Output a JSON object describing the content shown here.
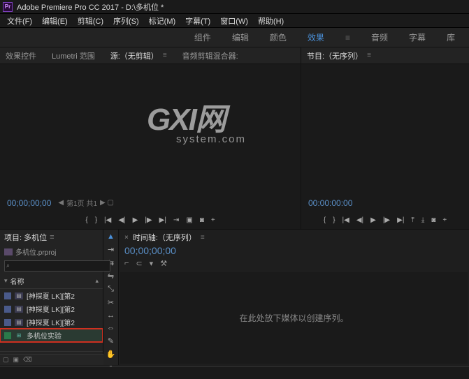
{
  "titlebar": {
    "app": "Adobe Premiere Pro CC 2017",
    "project_path": "D:\\多机位 *",
    "logo_text": "Pr"
  },
  "menubar": {
    "items": [
      "文件(F)",
      "编辑(E)",
      "剪辑(C)",
      "序列(S)",
      "标记(M)",
      "字幕(T)",
      "窗口(W)",
      "帮助(H)"
    ]
  },
  "workspace": {
    "tabs": [
      "组件",
      "编辑",
      "颜色",
      "效果",
      "音频",
      "字幕",
      "库"
    ],
    "active_index": 3
  },
  "source_panel": {
    "tabs": [
      "效果控件",
      "Lumetri 范围",
      "源:（无剪辑）",
      "音频剪辑混合器:"
    ],
    "active_index": 2,
    "timecode": "00;00;00;00",
    "frame_label": "第1页   共1"
  },
  "program_panel": {
    "title": "节目:（无序列）",
    "timecode": "00:00:00:00"
  },
  "project": {
    "title": "项目: 多机位",
    "file": "多机位.prproj",
    "search_placeholder": "",
    "columns": {
      "name": "名称"
    },
    "items": [
      {
        "swatch": "sw-blue",
        "type": "clip",
        "label": "[神探夏 LK][第2"
      },
      {
        "swatch": "sw-blue",
        "type": "clip",
        "label": "[神探夏 LK][第2"
      },
      {
        "swatch": "sw-blue",
        "type": "clip",
        "label": "[神探夏 LK][第2"
      },
      {
        "swatch": "sw-green",
        "type": "sequence",
        "label": "多机位实验",
        "highlighted": true
      }
    ]
  },
  "timeline": {
    "title": "时间轴:（无序列）",
    "timecode": "00;00;00;00",
    "empty_message": "在此处放下媒体以创建序列。"
  },
  "watermark": {
    "big": "GXI网",
    "sub": "system.com"
  }
}
